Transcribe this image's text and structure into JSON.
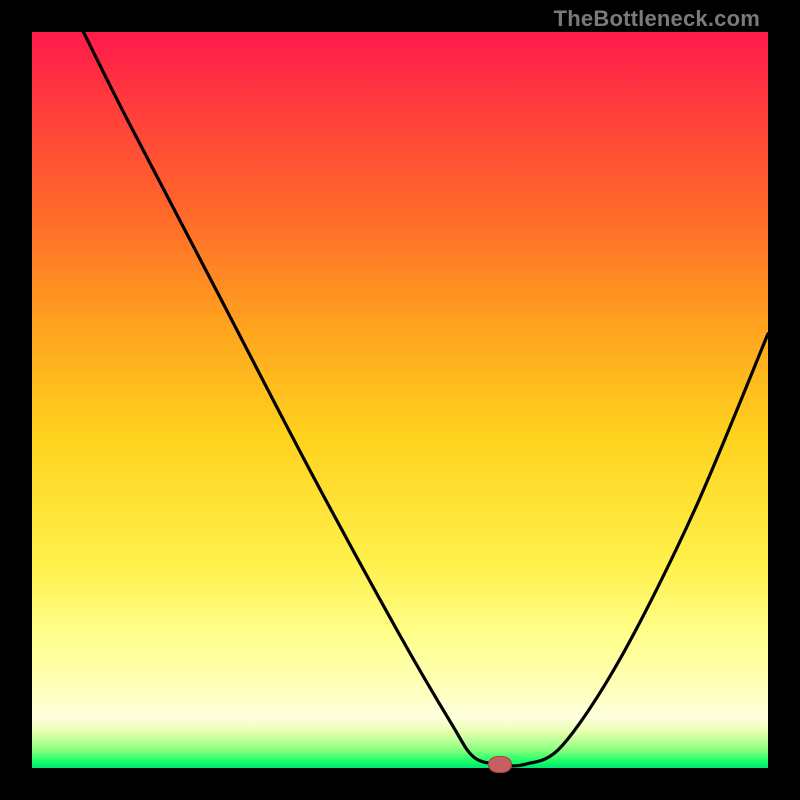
{
  "watermark": "TheBottleneck.com",
  "colors": {
    "frame_background": "#000000",
    "gradient_stops": [
      {
        "pos": 0,
        "color": "#ff1a4a"
      },
      {
        "pos": 0.1,
        "color": "#ff3c3c"
      },
      {
        "pos": 0.25,
        "color": "#ff6a2a"
      },
      {
        "pos": 0.4,
        "color": "#ffa31e"
      },
      {
        "pos": 0.55,
        "color": "#ffd21e"
      },
      {
        "pos": 0.72,
        "color": "#fff04a"
      },
      {
        "pos": 0.82,
        "color": "#ffff8c"
      },
      {
        "pos": 0.9,
        "color": "#ffffc0"
      },
      {
        "pos": 0.93,
        "color": "#ffffe0"
      },
      {
        "pos": 0.95,
        "color": "#e9ffb0"
      },
      {
        "pos": 0.975,
        "color": "#8cff80"
      },
      {
        "pos": 0.99,
        "color": "#1eff66"
      },
      {
        "pos": 1.0,
        "color": "#00e676"
      }
    ],
    "curve_stroke": "#000000",
    "marker_fill": "#c76060",
    "marker_border": "#a84040"
  },
  "chart_data": {
    "type": "line",
    "title": "",
    "xlabel": "",
    "ylabel": "",
    "xlim": [
      0,
      100
    ],
    "ylim": [
      0,
      100
    ],
    "grid": false,
    "series": [
      {
        "name": "bottleneck-curve",
        "x": [
          7,
          13,
          25,
          38,
          50,
          57,
          60,
          63.5,
          67,
          72,
          80,
          90,
          100
        ],
        "y": [
          100,
          88,
          65,
          40,
          18,
          6,
          1.5,
          0.5,
          0.5,
          3,
          15,
          35,
          59
        ]
      }
    ],
    "marker": {
      "x": 63.5,
      "y": 0.5,
      "label": ""
    },
    "annotations": []
  }
}
